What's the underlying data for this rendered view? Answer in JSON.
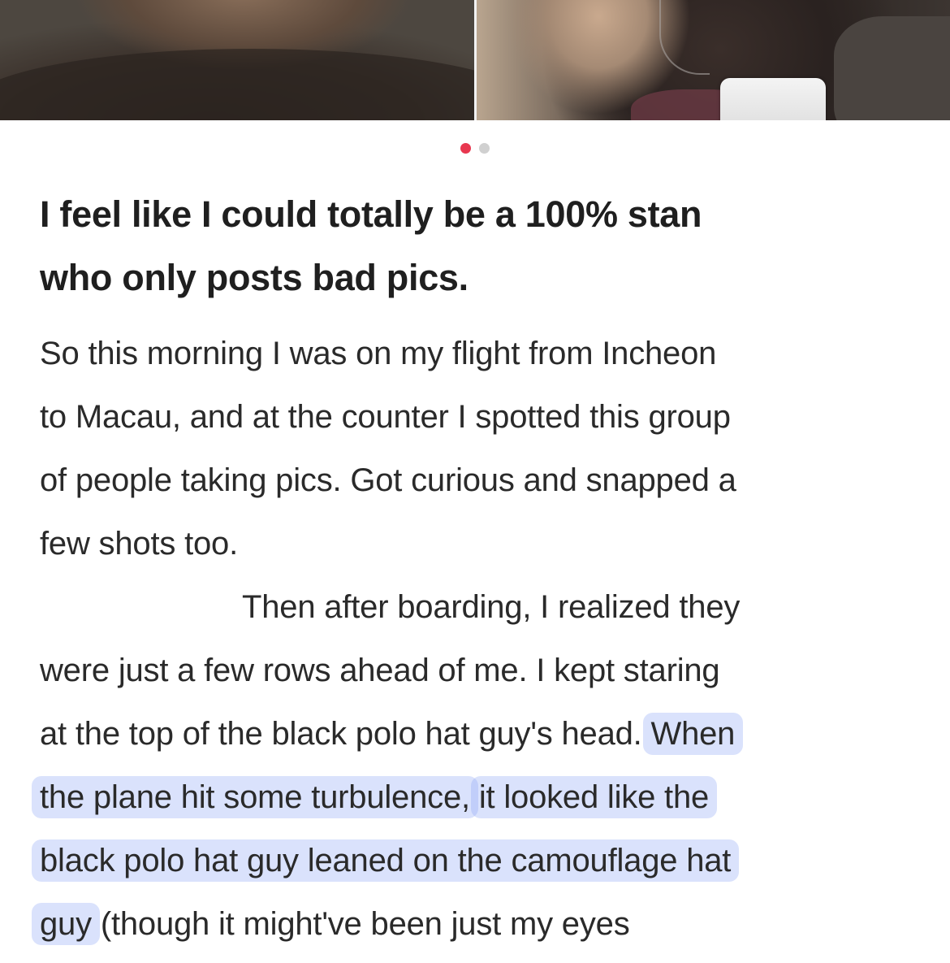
{
  "gallery": {
    "photos": [
      "photo-1",
      "photo-2"
    ],
    "active_index": 0,
    "dot_colors": {
      "active": "#e8374f",
      "inactive": "#d0d0d0"
    }
  },
  "post": {
    "title_line_1": "I feel like I could totally be a 100% stan",
    "title_line_2": "who only posts bad pics.",
    "body": {
      "line_1": "So this morning I was on my flight from Incheon",
      "line_2": "to Macau, and at the counter I spotted this group",
      "line_3": "of people taking pics. Got curious and snapped a",
      "line_4": "few shots too.",
      "line_5": "Then after boarding, I realized they",
      "line_6": "were just a few rows ahead of me. I kept staring",
      "line_7_plain": "at the top of the black polo hat guy's head. ",
      "line_7_highlight": "When",
      "line_8_highlight_a": "the plane hit some turbulence,",
      "line_8_highlight_b": "it looked like the",
      "line_9_highlight": "black polo hat guy leaned on the camouflage hat",
      "line_10_highlight": "guy",
      "line_10_plain": " (though it might've been just my eyes"
    },
    "highlight_color": "#8ca5f5"
  }
}
